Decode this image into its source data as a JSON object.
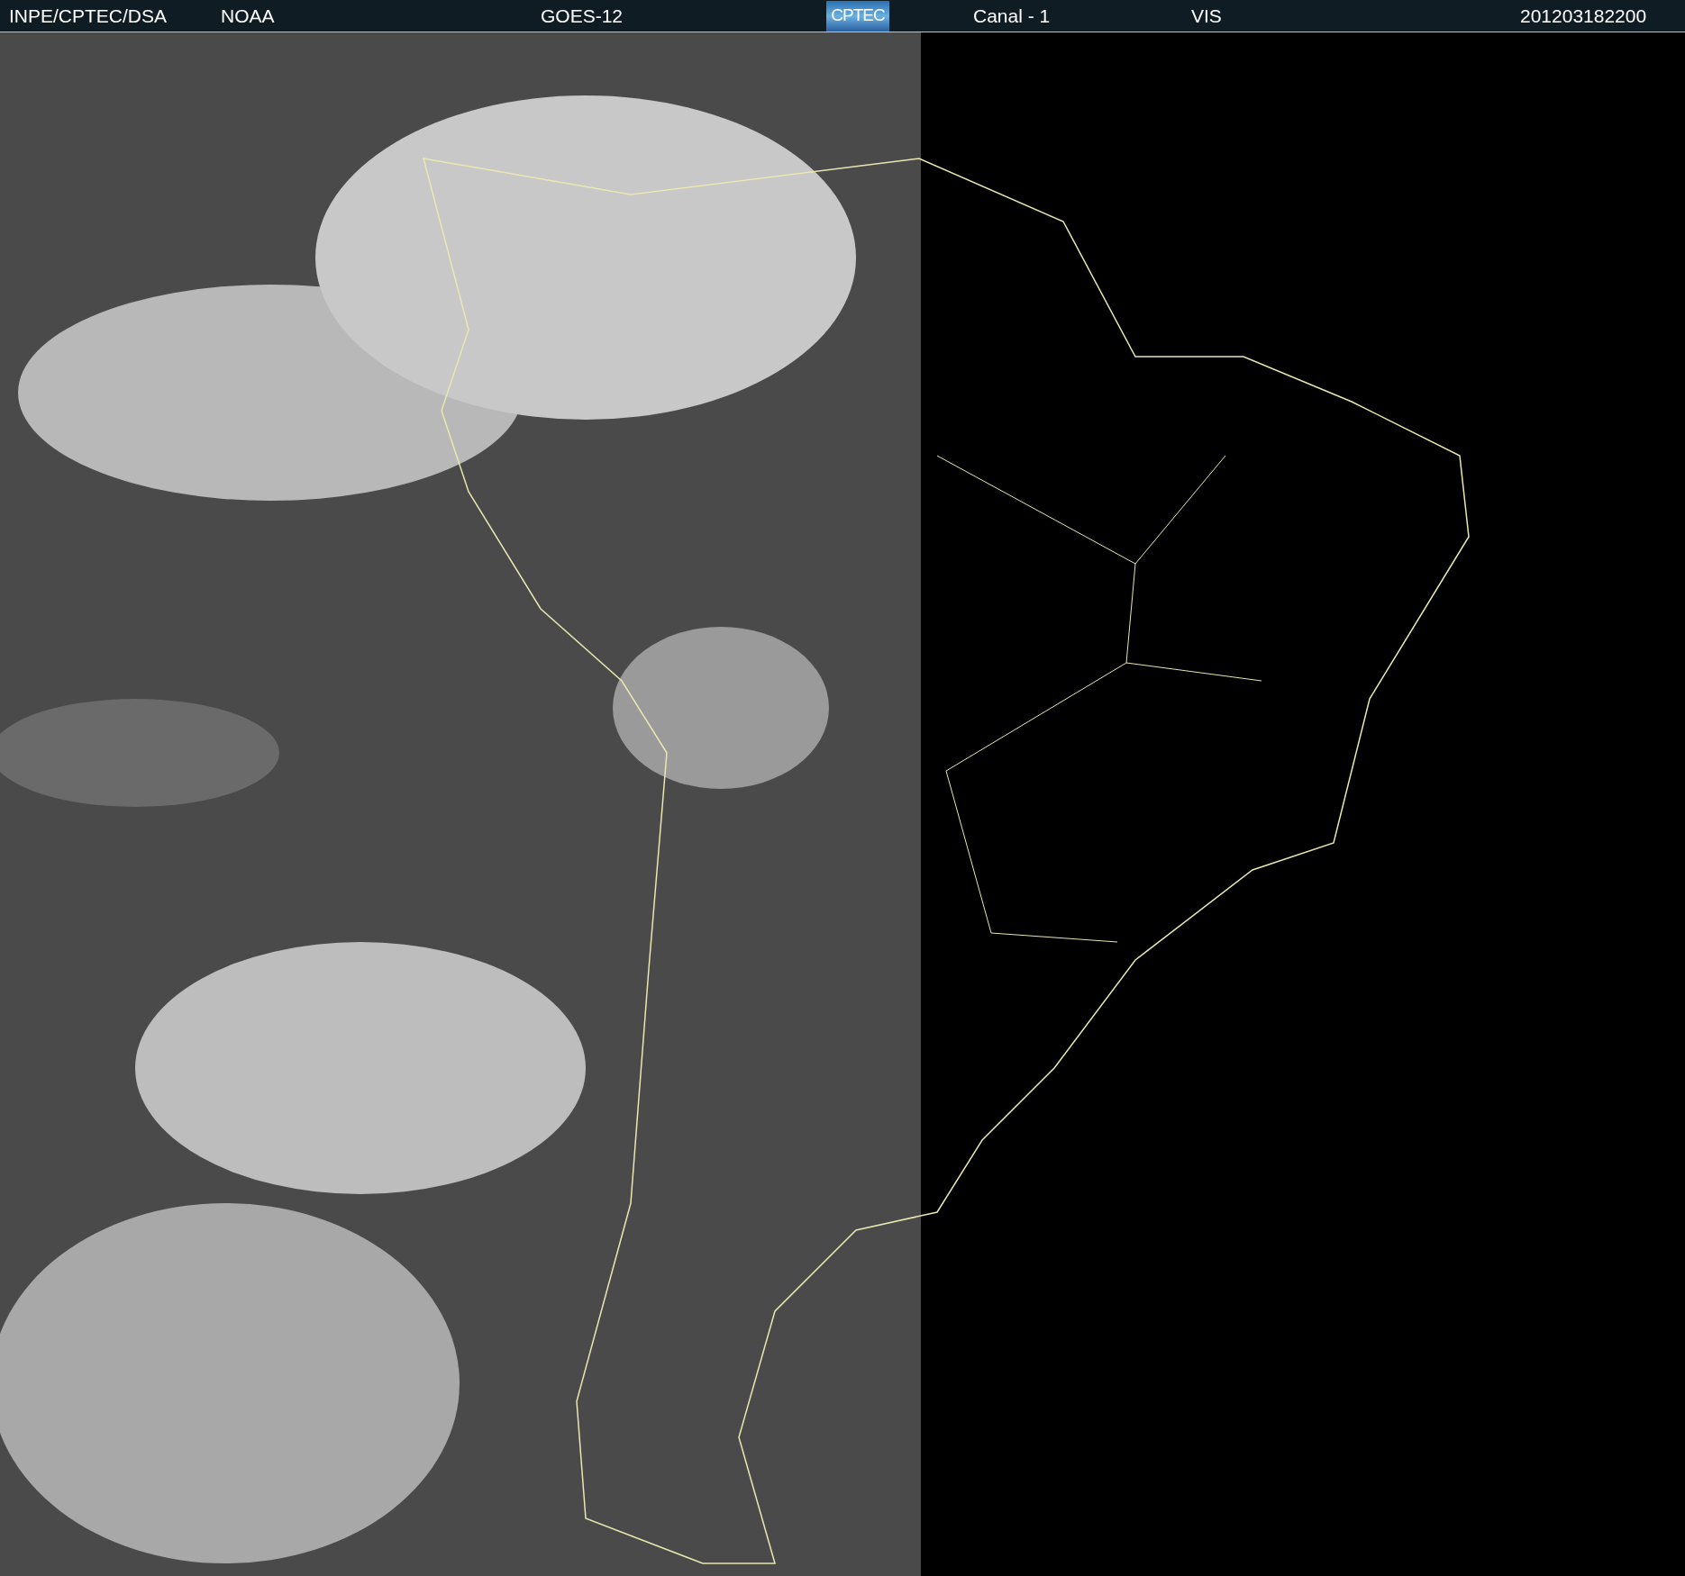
{
  "header": {
    "agency": "INPE/CPTEC/DSA",
    "source": "NOAA",
    "satellite": "GOES-12",
    "logo": "CPTEC",
    "channel": "Canal - 1",
    "band": "VIS",
    "timestamp": "201203182200"
  }
}
